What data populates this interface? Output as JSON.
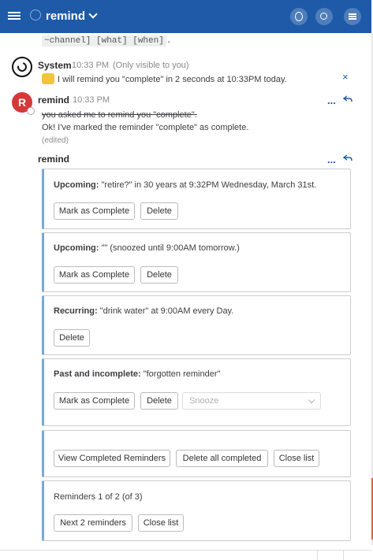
{
  "header": {
    "channel": "remind"
  },
  "cutoff_code": "~channel] [what] [when]",
  "cutoff_suffix": ".",
  "system_msg": {
    "name": "System",
    "time": "10:33 PM",
    "note": "(Only visible to you)",
    "text": "I will remind you \"complete\" in 2 seconds at 10:33PM today.",
    "close": "×"
  },
  "remind_msg": {
    "avatar_letter": "R",
    "name": "remind",
    "time": "10:33 PM",
    "struck": "you asked me to remind you \"complete\".",
    "text": "Ok! I've marked the reminder \"complete\" as complete.",
    "edited": "(edited)",
    "more": "...",
    "name2": "remind",
    "more2": "..."
  },
  "cards": [
    {
      "label": "Upcoming:",
      "text": "\"retire?\" in 30 years at 9:32PM Wednesday, March 31st.",
      "btn_complete": "Mark as Complete",
      "btn_delete": "Delete"
    },
    {
      "label": "Upcoming:",
      "text": "\"\" (snoozed until 9:00AM tomorrow.)",
      "btn_complete": "Mark as Complete",
      "btn_delete": "Delete"
    },
    {
      "label": "Recurring:",
      "text": "\"drink water\" at 9:00AM every Day.",
      "btn_delete": "Delete"
    },
    {
      "label": "Past and incomplete:",
      "text": "\"forgotten reminder\"",
      "btn_complete": "Mark as Complete",
      "btn_delete": "Delete",
      "snooze_placeholder": "Snooze"
    }
  ],
  "actions": {
    "view_completed": "View Completed Reminders",
    "delete_completed": "Delete all completed",
    "close_list": "Close list"
  },
  "pager": {
    "text": "Reminders 1 of 2 (of 3)",
    "next": "Next 2 reminders",
    "close": "Close list"
  },
  "colors": {
    "header": "#1e5aa8",
    "card_accent": "#7aa7d6",
    "avatar_remind": "#d63838"
  },
  "icons": [
    "hamburger-icon",
    "at-icon",
    "chevron-down-icon",
    "info-icon",
    "search-icon",
    "menu-icon",
    "thumbs-up-icon",
    "reply-icon",
    "close-icon"
  ]
}
